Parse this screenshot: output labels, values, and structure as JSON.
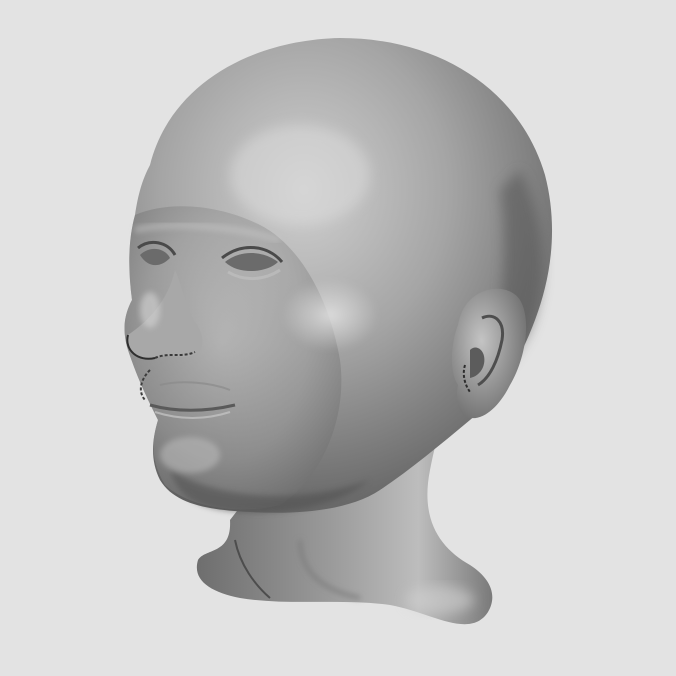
{
  "scene": {
    "background_color": "#e3e3e3",
    "surface_color": "#9a9a9a",
    "highlight_color": "#cfcfcf",
    "shadow_color": "#3f3f3f",
    "subject": "3d-head-model"
  }
}
